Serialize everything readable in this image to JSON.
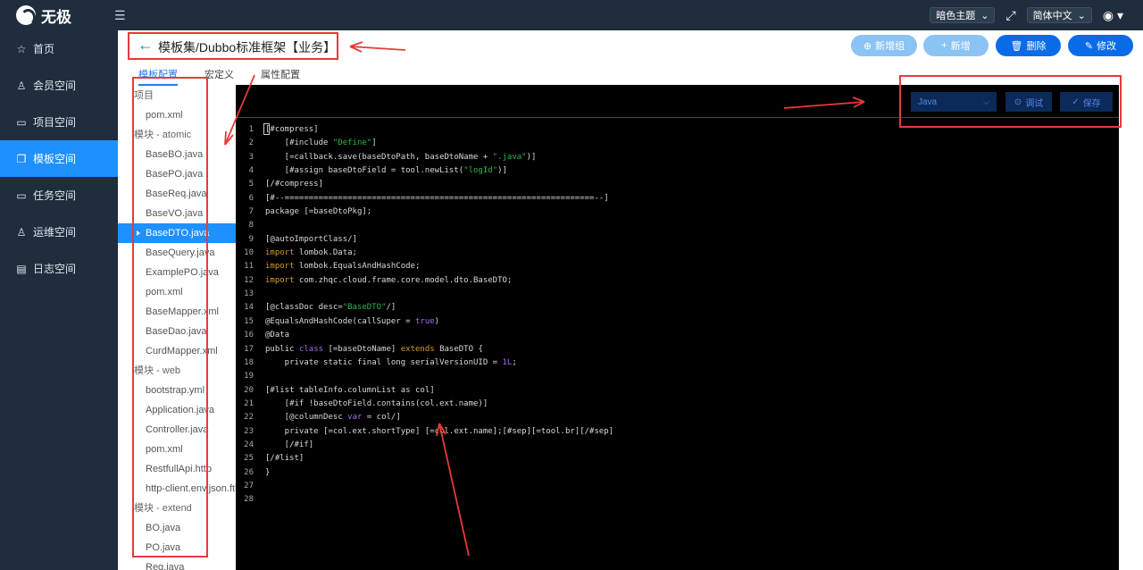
{
  "topbar": {
    "logo": "无极",
    "menu_toggle_icon": "menu-toggle-icon",
    "theme_select": "暗色主题",
    "fullscreen_icon": "fullscreen-icon",
    "language_select": "简体中文",
    "user_icon": "user-avatar-icon"
  },
  "sidebar": {
    "items": [
      {
        "label": "首页",
        "icon": "☆"
      },
      {
        "label": "会员空间",
        "icon": "♙"
      },
      {
        "label": "项目空间",
        "icon": "▭"
      },
      {
        "label": "模板空间",
        "icon": "❐"
      },
      {
        "label": "任务空间",
        "icon": "▭"
      },
      {
        "label": "运维空间",
        "icon": "♙"
      },
      {
        "label": "日志空间",
        "icon": "▤"
      }
    ],
    "active_index": 3
  },
  "header": {
    "back_icon": "←",
    "title": "模板集/Dubbo标准框架【业务】",
    "buttons": {
      "add_group": "新增组",
      "add": "新增",
      "delete": "删除",
      "edit": "修改"
    }
  },
  "tabs": [
    "模板配置",
    "宏定义",
    "属性配置"
  ],
  "tree": [
    {
      "type": "group",
      "label": "项目"
    },
    {
      "type": "file",
      "label": "pom.xml"
    },
    {
      "type": "group",
      "label": "模块 - atomic"
    },
    {
      "type": "file",
      "label": "BaseBO.java"
    },
    {
      "type": "file",
      "label": "BasePO.java"
    },
    {
      "type": "file",
      "label": "BaseReq.java"
    },
    {
      "type": "file",
      "label": "BaseVO.java"
    },
    {
      "type": "file",
      "label": "BaseDTO.java",
      "selected": true
    },
    {
      "type": "file",
      "label": "BaseQuery.java"
    },
    {
      "type": "file",
      "label": "ExamplePO.java"
    },
    {
      "type": "file",
      "label": "pom.xml"
    },
    {
      "type": "file",
      "label": "BaseMapper.xml"
    },
    {
      "type": "file",
      "label": "BaseDao.java"
    },
    {
      "type": "file",
      "label": "CurdMapper.xml"
    },
    {
      "type": "group",
      "label": "模块 - web"
    },
    {
      "type": "file",
      "label": "bootstrap.yml"
    },
    {
      "type": "file",
      "label": "Application.java"
    },
    {
      "type": "file",
      "label": "Controller.java"
    },
    {
      "type": "file",
      "label": "pom.xml"
    },
    {
      "type": "file",
      "label": "RestfullApi.http"
    },
    {
      "type": "file",
      "label": "http-client.env.json.ftl"
    },
    {
      "type": "group",
      "label": "模块 - extend"
    },
    {
      "type": "file",
      "label": "BO.java"
    },
    {
      "type": "file",
      "label": "PO.java"
    },
    {
      "type": "file",
      "label": "Req.java"
    }
  ],
  "editor": {
    "language": "Java",
    "debug_label": "调试",
    "save_label": "保存",
    "lines": [
      [
        [
          "[#compress]",
          "#d9d9d9"
        ]
      ],
      [
        [
          "    [#include ",
          "#d9d9d9"
        ],
        [
          "\"Define\"",
          "#2fb84a"
        ],
        [
          "]",
          "#d9d9d9"
        ]
      ],
      [
        [
          "    [=callback.save(baseDtoPath, baseDtoName + ",
          "#d9d9d9"
        ],
        [
          "\".java\"",
          "#2fb84a"
        ],
        [
          ")]",
          "#d9d9d9"
        ]
      ],
      [
        [
          "    [#assign baseDtoField = tool.newList(",
          "#d9d9d9"
        ],
        [
          "\"logId\"",
          "#2fb84a"
        ],
        [
          ")]",
          "#d9d9d9"
        ]
      ],
      [
        [
          "[/#compress]",
          "#d9d9d9"
        ]
      ],
      [
        [
          "[#--================================================================--]",
          "#d9d9d9"
        ]
      ],
      [
        [
          "package [=baseDtoPkg];",
          "#d9d9d9"
        ]
      ],
      [
        [
          "",
          "#d9d9d9"
        ]
      ],
      [
        [
          "[@autoImportClass/]",
          "#d9d9d9"
        ]
      ],
      [
        [
          "import",
          "#d99a2b"
        ],
        [
          " lombok.Data;",
          "#d9d9d9"
        ]
      ],
      [
        [
          "import",
          "#d99a2b"
        ],
        [
          " lombok.EqualsAndHashCode;",
          "#d9d9d9"
        ]
      ],
      [
        [
          "import",
          "#d99a2b"
        ],
        [
          " com.zhqc.cloud.frame.core.model.dto.BaseDTO;",
          "#d9d9d9"
        ]
      ],
      [
        [
          "",
          "#d9d9d9"
        ]
      ],
      [
        [
          "[@classDoc desc=",
          "#d9d9d9"
        ],
        [
          "\"BaseDTO\"",
          "#2fb84a"
        ],
        [
          "/]",
          "#d9d9d9"
        ]
      ],
      [
        [
          "@EqualsAndHashCode(callSuper = ",
          "#d9d9d9"
        ],
        [
          "true",
          "#a26cf0"
        ],
        [
          ")",
          "#d9d9d9"
        ]
      ],
      [
        [
          "@Data",
          "#d9d9d9"
        ]
      ],
      [
        [
          "public ",
          "#d9d9d9"
        ],
        [
          "class",
          "#a26cf0"
        ],
        [
          " [=baseDtoName] ",
          "#d9d9d9"
        ],
        [
          "extends",
          "#d99a2b"
        ],
        [
          " BaseDTO {",
          "#d9d9d9"
        ]
      ],
      [
        [
          "    private static final long serialVersionUID = ",
          "#d9d9d9"
        ],
        [
          "1L",
          "#a26cf0"
        ],
        [
          ";",
          "#d9d9d9"
        ]
      ],
      [
        [
          "",
          "#d9d9d9"
        ]
      ],
      [
        [
          "[#list tableInfo.columnList as col]",
          "#d9d9d9"
        ]
      ],
      [
        [
          "    [#if !baseDtoField.contains(col.ext.name)]",
          "#d9d9d9"
        ]
      ],
      [
        [
          "    [@columnDesc ",
          "#d9d9d9"
        ],
        [
          "var",
          "#a26cf0"
        ],
        [
          " = col/]",
          "#d9d9d9"
        ]
      ],
      [
        [
          "    private [=col.ext.shortType] [=col.ext.name];[#sep][=tool.br][/#sep]",
          "#d9d9d9"
        ]
      ],
      [
        [
          "    [/#if]",
          "#d9d9d9"
        ]
      ],
      [
        [
          "[/#list]",
          "#d9d9d9"
        ]
      ],
      [
        [
          "}",
          "#d9d9d9"
        ]
      ],
      [
        [
          "",
          "#d9d9d9"
        ]
      ],
      [
        [
          "",
          "#d9d9d9"
        ]
      ]
    ]
  },
  "colors": {
    "sidebar_bg": "#1f2d3d",
    "accent": "#1e90ff",
    "primary_button": "#0a6be8",
    "annotation_red": "#e83a3a",
    "editor_bg": "#000000"
  }
}
